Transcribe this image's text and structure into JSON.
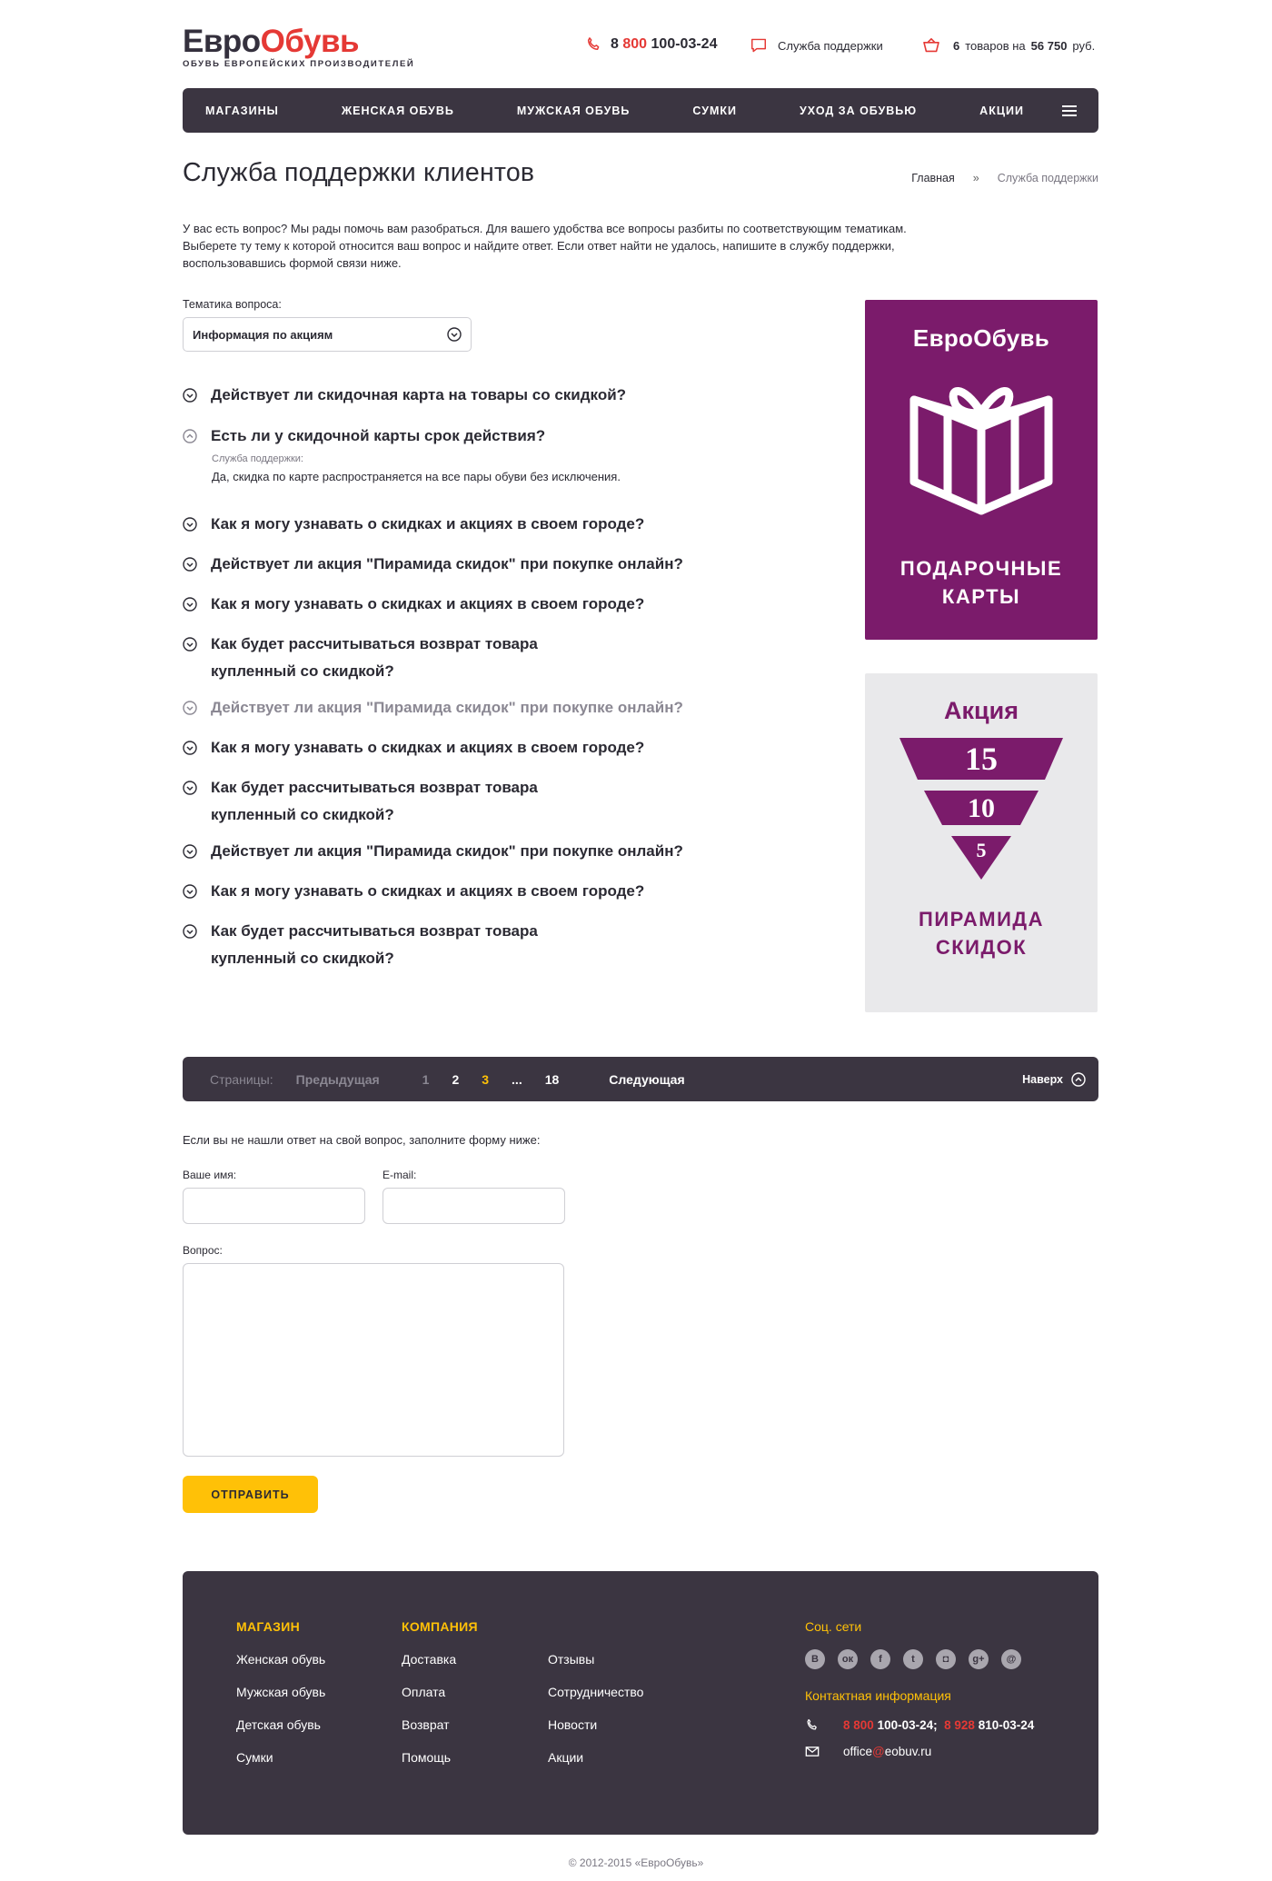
{
  "header": {
    "logo_part1": "Евро",
    "logo_part2": "Обувь",
    "logo_tagline": "ОБУВЬ ЕВРОПЕЙСКИХ ПРОИЗВОДИТЕЛЕЙ",
    "phone_prefix": "8",
    "phone_code": "800",
    "phone_number": "100-03-24",
    "support_label": "Служба поддержки",
    "cart_count": "6",
    "cart_text1": "товаров на",
    "cart_sum": "56 750",
    "cart_currency": "руб."
  },
  "nav": {
    "items": [
      "МАГАЗИНЫ",
      "ЖЕНСКАЯ ОБУВЬ",
      "МУЖСКАЯ ОБУВЬ",
      "СУМКИ",
      "УХОД ЗА ОБУВЬЮ",
      "АКЦИИ"
    ]
  },
  "page": {
    "title": "Служба поддержки клиентов",
    "breadcrumb_home": "Главная",
    "breadcrumb_sep": "»",
    "breadcrumb_current": "Служба поддержки",
    "intro_line1": "У вас есть вопрос? Мы рады помочь вам разобраться. Для вашего удобства все вопросы разбиты по соответствующим тематикам.",
    "intro_line2": "Выберете ту тему к которой относится ваш вопрос и найдите ответ. Если ответ найти не удалось, напишите в службу поддержки,",
    "intro_line3": "воспользовавшись формой связи ниже."
  },
  "topic": {
    "label": "Тематика вопроса:",
    "selected": "Информация по акциям"
  },
  "faq": {
    "items": [
      {
        "q1": "Действует ли скидочная карта на товары со скидкой?",
        "q2": ""
      },
      {
        "q1": "Есть ли у скидочной карты срок действия?",
        "q2": "",
        "answer_who": "Служба поддержки:",
        "answer": "Да, скидка по карте распространяется на все пары обуви без исключения."
      },
      {
        "q1": "Как я могу узнавать о скидках и акциях в своем городе?",
        "q2": ""
      },
      {
        "q1": "Действует ли акция \"Пирамида скидок\" при покупке онлайн?",
        "q2": ""
      },
      {
        "q1": "Как я могу узнавать о скидках и акциях в своем городе?",
        "q2": ""
      },
      {
        "q1": "Как будет рассчитываться возврат товара",
        "q2": "купленный со скидкой?"
      },
      {
        "q1": "Действует ли акция \"Пирамида скидок\" при покупке онлайн?",
        "q2": ""
      },
      {
        "q1": "Как я могу узнавать о скидках и акциях в своем городе?",
        "q2": ""
      },
      {
        "q1": "Как будет рассчитываться возврат товара",
        "q2": "купленный со скидкой?"
      },
      {
        "q1": "Действует ли акция \"Пирамида скидок\" при покупке онлайн?",
        "q2": ""
      },
      {
        "q1": "Как я могу узнавать о скидках и акциях в своем городе?",
        "q2": ""
      },
      {
        "q1": "Как будет рассчитываться возврат товара",
        "q2": "купленный со скидкой?"
      }
    ]
  },
  "banners": {
    "gift_brand": "ЕвроОбувь",
    "gift_cap1": "ПОДАРОЧНЫЕ",
    "gift_cap2": "КАРТЫ",
    "promo_title": "Акция",
    "promo_levels": [
      "15",
      "10",
      "5"
    ],
    "promo_cap1": "ПИРАМИДА",
    "promo_cap2": "СКИДОК",
    "accent_color": "#7b1b6b"
  },
  "pager": {
    "label": "Страницы:",
    "prev": "Предыдущая",
    "pages": [
      "1",
      "2",
      "3",
      "...",
      "18"
    ],
    "current": "3",
    "next": "Следующая",
    "top": "Наверх"
  },
  "form": {
    "intro": "Если вы не нашли ответ на свой вопрос, заполните форму ниже:",
    "name_label": "Ваше имя:",
    "email_label": "E-mail:",
    "question_label": "Вопрос:",
    "submit": "ОТПРАВИТЬ"
  },
  "footer": {
    "col1_title": "МАГАЗИН",
    "col1": [
      "Женская обувь",
      "Мужская обувь",
      "Детская обувь",
      "Сумки"
    ],
    "col2_title": "КОМПАНИЯ",
    "col2": [
      "Доставка",
      "Оплата",
      "Возврат",
      "Помощь"
    ],
    "col3": [
      "Отзывы",
      "Сотрудничество",
      "Новости",
      "Акции"
    ],
    "social_title": "Соц. сети",
    "social_icons": [
      "vk-icon",
      "odnoklassniki-icon",
      "facebook-icon",
      "twitter-icon",
      "instagram-icon",
      "google-plus-icon",
      "mail-icon"
    ],
    "social_glyphs": [
      "В",
      "ок",
      "f",
      "t",
      "◘",
      "g+",
      "@"
    ],
    "contacts_title": "Контактная информация",
    "phone1_prefix": "8 800",
    "phone1_num": "100-03-24;",
    "phone2_prefix": "8 928",
    "phone2_num": "810-03-24",
    "email_user": "office",
    "email_at": "@",
    "email_domain": "eobuv.ru"
  },
  "copyright": "© 2012-2015 «ЕвроОбувь»",
  "colors": {
    "nav_bg": "#3b3541",
    "accent_yellow": "#ffc107",
    "accent_red": "#e53935"
  }
}
